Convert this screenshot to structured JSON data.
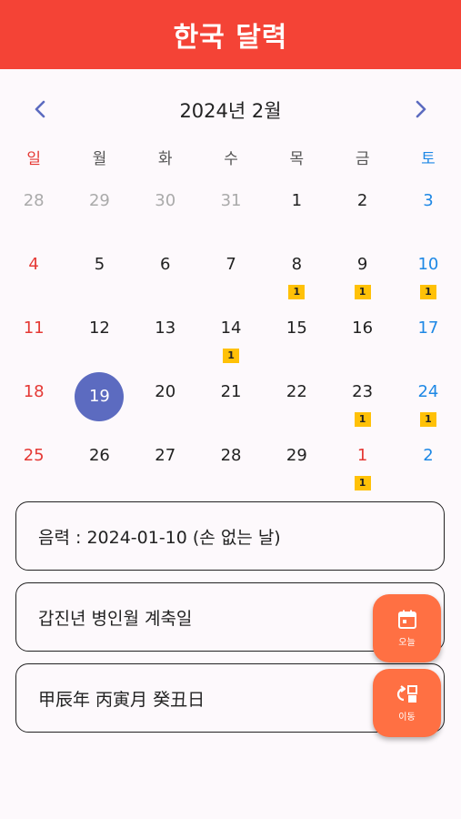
{
  "appbar": {
    "title": "한국 달력"
  },
  "nav": {
    "month_title": "2024년 2월",
    "prev_icon": "chevron-left-icon",
    "next_icon": "chevron-right-icon"
  },
  "weekdays": [
    "일",
    "월",
    "화",
    "수",
    "목",
    "금",
    "토"
  ],
  "weeks": [
    [
      {
        "day": "28",
        "other": true
      },
      {
        "day": "29",
        "other": true
      },
      {
        "day": "30",
        "other": true
      },
      {
        "day": "31",
        "other": true
      },
      {
        "day": "1"
      },
      {
        "day": "2"
      },
      {
        "day": "3"
      }
    ],
    [
      {
        "day": "4"
      },
      {
        "day": "5"
      },
      {
        "day": "6"
      },
      {
        "day": "7"
      },
      {
        "day": "8",
        "badge": "1"
      },
      {
        "day": "9",
        "badge": "1"
      },
      {
        "day": "10",
        "badge": "1"
      }
    ],
    [
      {
        "day": "11"
      },
      {
        "day": "12"
      },
      {
        "day": "13"
      },
      {
        "day": "14",
        "badge": "1"
      },
      {
        "day": "15"
      },
      {
        "day": "16"
      },
      {
        "day": "17"
      }
    ],
    [
      {
        "day": "18"
      },
      {
        "day": "19",
        "today": true
      },
      {
        "day": "20"
      },
      {
        "day": "21"
      },
      {
        "day": "22"
      },
      {
        "day": "23",
        "badge": "1"
      },
      {
        "day": "24",
        "badge": "1"
      }
    ],
    [
      {
        "day": "25"
      },
      {
        "day": "26"
      },
      {
        "day": "27"
      },
      {
        "day": "28"
      },
      {
        "day": "29"
      },
      {
        "day": "1",
        "other": true,
        "badge": "1",
        "red": true
      },
      {
        "day": "2",
        "other": true
      }
    ]
  ],
  "info": {
    "lunar": "음력 : 2024-01-10 (손 없는 날)",
    "ganji_korean": "갑진년 병인월 계축일",
    "ganji_hanja": "甲辰年 丙寅月 癸丑日"
  },
  "fab": {
    "today_label": "오늘",
    "today_icon": "calendar-icon",
    "move_label": "이동",
    "move_icon": "swap-icon"
  },
  "colors": {
    "appbar": "#f44336",
    "sunday": "#e53935",
    "saturday": "#1e88e5",
    "today": "#5c6bc0",
    "badge": "#ffc107",
    "fab": "#ff7043"
  }
}
